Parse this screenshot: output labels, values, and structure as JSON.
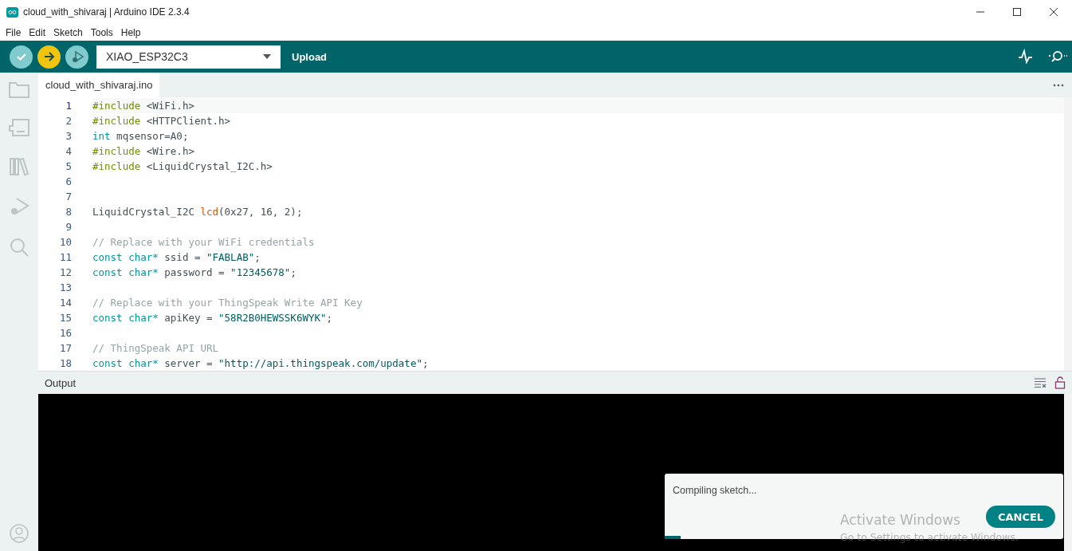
{
  "window": {
    "title": "cloud_with_shivaraj | Arduino IDE 2.3.4"
  },
  "menu": [
    "File",
    "Edit",
    "Sketch",
    "Tools",
    "Help"
  ],
  "toolbar": {
    "buttons": [
      {
        "kind": "verify",
        "active": false
      },
      {
        "kind": "upload",
        "active": true
      },
      {
        "kind": "debug",
        "active": false
      }
    ],
    "board": "XIAO_ESP32C3",
    "tooltip": "Upload"
  },
  "tabs": [
    {
      "label": "cloud_with_shivaraj.ino",
      "selected": true
    }
  ],
  "editor": {
    "lines": [
      {
        "number": "1",
        "current": true,
        "tokens": [
          {
            "kind": "directive",
            "text": "#include"
          },
          {
            "kind": "plain",
            "text": " <WiFi.h>"
          }
        ]
      },
      {
        "number": "2",
        "current": false,
        "tokens": [
          {
            "kind": "directive",
            "text": "#include"
          },
          {
            "kind": "plain",
            "text": " <HTTPClient.h>"
          }
        ]
      },
      {
        "number": "3",
        "current": false,
        "tokens": [
          {
            "kind": "keyword",
            "text": "int"
          },
          {
            "kind": "plain",
            "text": " mqsensor=A0;"
          }
        ]
      },
      {
        "number": "4",
        "current": false,
        "tokens": [
          {
            "kind": "directive",
            "text": "#include"
          },
          {
            "kind": "plain",
            "text": " <Wire.h>"
          }
        ]
      },
      {
        "number": "5",
        "current": false,
        "tokens": [
          {
            "kind": "directive",
            "text": "#include"
          },
          {
            "kind": "plain",
            "text": " <LiquidCrystal_I2C.h>"
          }
        ]
      },
      {
        "number": "6",
        "current": false
      },
      {
        "number": "7",
        "current": false
      },
      {
        "number": "8",
        "current": false,
        "tokens": [
          {
            "kind": "plain",
            "text": "LiquidCrystal_I2C "
          },
          {
            "kind": "function",
            "text": "lcd"
          },
          {
            "kind": "plain",
            "text": "(0x27, 16, 2);"
          }
        ]
      },
      {
        "number": "9",
        "current": false
      },
      {
        "number": "10",
        "current": false,
        "tokens": [
          {
            "kind": "comment",
            "text": "// Replace with your WiFi credentials"
          }
        ]
      },
      {
        "number": "11",
        "current": false,
        "tokens": [
          {
            "kind": "keyword",
            "text": "const char*"
          },
          {
            "kind": "plain",
            "text": " ssid = "
          },
          {
            "kind": "string",
            "text": "\"FABLAB\""
          },
          {
            "kind": "plain",
            "text": ";"
          }
        ]
      },
      {
        "number": "12",
        "current": false,
        "tokens": [
          {
            "kind": "keyword",
            "text": "const char*"
          },
          {
            "kind": "plain",
            "text": " password = "
          },
          {
            "kind": "string",
            "text": "\"12345678\""
          },
          {
            "kind": "plain",
            "text": ";"
          }
        ]
      },
      {
        "number": "13",
        "current": false
      },
      {
        "number": "14",
        "current": false,
        "tokens": [
          {
            "kind": "comment",
            "text": "// Replace with your ThingSpeak Write API Key"
          }
        ]
      },
      {
        "number": "15",
        "current": false,
        "tokens": [
          {
            "kind": "keyword",
            "text": "const char*"
          },
          {
            "kind": "plain",
            "text": " apiKey = "
          },
          {
            "kind": "string",
            "text": "\"58R2B0HEWSSK6WYK\""
          },
          {
            "kind": "plain",
            "text": ";"
          }
        ]
      },
      {
        "number": "16",
        "current": false
      },
      {
        "number": "17",
        "current": false,
        "tokens": [
          {
            "kind": "comment",
            "text": "// ThingSpeak API URL"
          }
        ]
      },
      {
        "number": "18",
        "current": false,
        "tokens": [
          {
            "kind": "keyword",
            "text": "const char*"
          },
          {
            "kind": "plain",
            "text": " server = "
          },
          {
            "kind": "string",
            "text": "\"http://api.thingspeak.com/update\""
          },
          {
            "kind": "plain",
            "text": ";"
          }
        ]
      }
    ]
  },
  "output": {
    "title": "Output"
  },
  "notification": {
    "message": "Compiling sketch...",
    "button": "CANCEL",
    "level": 0.04
  },
  "os_overlay": {
    "title": "Activate Windows",
    "subtitle": "Go to Settings to activate Windows."
  }
}
